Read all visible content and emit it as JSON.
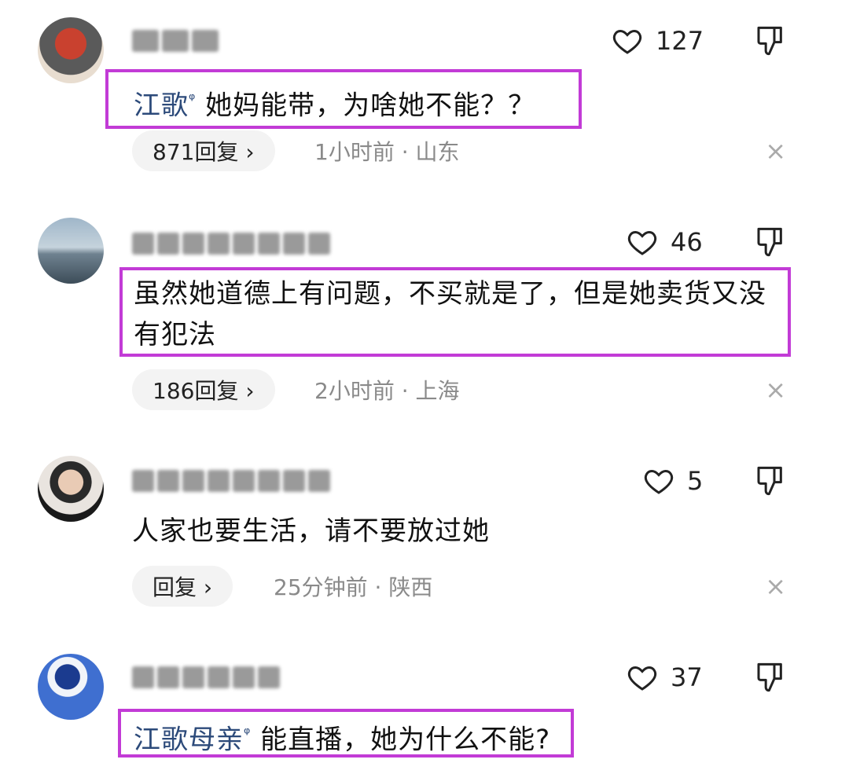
{
  "comments": [
    {
      "likes": "127",
      "mention": "江歌",
      "text": "她妈能带，为啥她不能？？",
      "reply": "871回复 ›",
      "meta": "1小时前 · 山东"
    },
    {
      "likes": "46",
      "mention": "",
      "text": "虽然她道德上有问题，不买就是了，但是她卖货又没有犯法",
      "reply": "186回复 ›",
      "meta": "2小时前 · 上海"
    },
    {
      "likes": "5",
      "mention": "",
      "text": "人家也要生活，请不要放过她",
      "reply": "回复 ›",
      "meta": "25分钟前 · 陕西"
    },
    {
      "likes": "37",
      "mention": "江歌母亲",
      "text": "能直播，她为什么不能?",
      "reply": "",
      "meta": ""
    }
  ],
  "icons": {
    "search_mark": "search-icon",
    "close": "×"
  },
  "colors": {
    "highlight_border": "#c23bd6",
    "mention": "#2c4a7a"
  }
}
